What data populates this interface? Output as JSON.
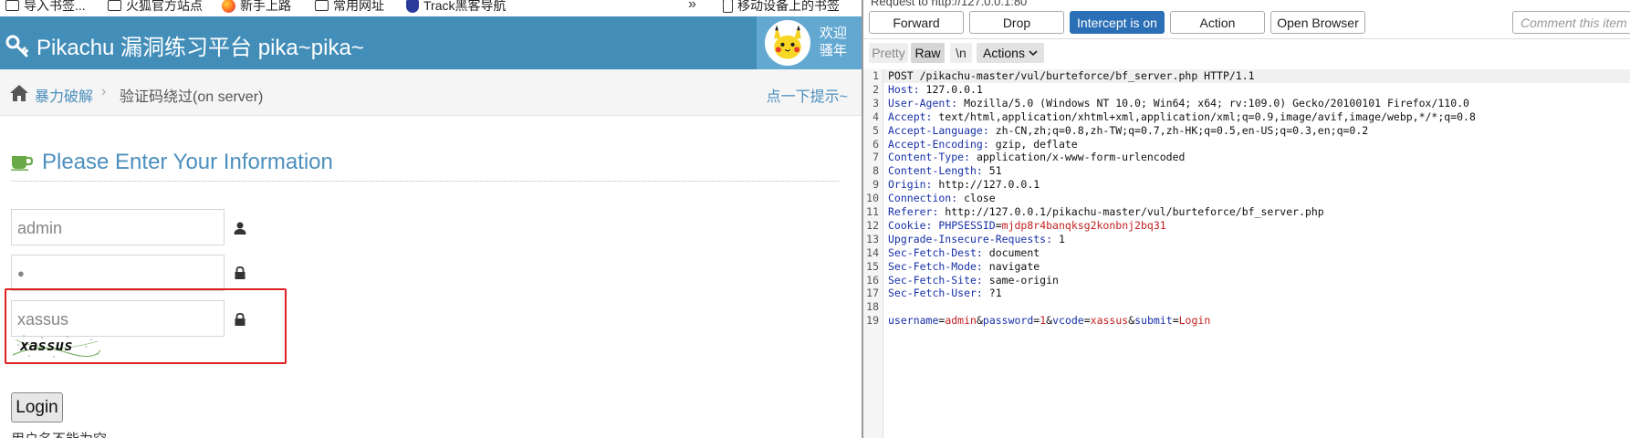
{
  "bookmarks": [
    {
      "label": "导入书签...",
      "icon": "folder-icon"
    },
    {
      "label": "火狐官方站点",
      "icon": "folder-icon"
    },
    {
      "label": "新手上路",
      "icon": "firefox-icon"
    },
    {
      "label": "常用网址",
      "icon": "folder-icon"
    },
    {
      "label": "Track黑客导航",
      "icon": "track-icon"
    },
    {
      "label": "移动设备上的书签",
      "icon": "device-icon"
    }
  ],
  "header": {
    "app_title": "Pikachu 漏洞练习平台 pika~pika~",
    "welcome_line1": "欢迎",
    "welcome_line2": "骚年"
  },
  "breadcrumb": {
    "section": "暴力破解",
    "page": "验证码绕过(on server)",
    "hint": "点一下提示~"
  },
  "form": {
    "title": "Please Enter Your Information",
    "username_value": "admin",
    "password_value": "●",
    "vcode_value": "xassus",
    "captcha_text": "xassus",
    "login_label": "Login",
    "bottom_text": "用户名不能为空"
  },
  "burp": {
    "request_to": "Request to http://127.0.0.1:80",
    "buttons": {
      "forward": "Forward",
      "drop": "Drop",
      "intercept": "Intercept is on",
      "action": "Action",
      "open_browser": "Open Browser"
    },
    "comment_placeholder": "Comment this item",
    "tabs": {
      "pretty": "Pretty",
      "raw": "Raw",
      "newline": "\\n",
      "actions": "Actions"
    },
    "accent_color": "#2b6fb6",
    "lines": [
      {
        "n": "1",
        "parts": [
          {
            "t": "POST /pikachu-master/vul/burteforce/bf_server.php HTTP/1.1",
            "c": ""
          }
        ]
      },
      {
        "n": "2",
        "parts": [
          {
            "t": "Host:",
            "c": "k"
          },
          {
            "t": " 127.0.0.1",
            "c": ""
          }
        ]
      },
      {
        "n": "3",
        "parts": [
          {
            "t": "User-Agent:",
            "c": "k"
          },
          {
            "t": " Mozilla/5.0 (Windows NT 10.0; Win64; x64; rv:109.0) Gecko/20100101 Firefox/110.0",
            "c": ""
          }
        ]
      },
      {
        "n": "4",
        "parts": [
          {
            "t": "Accept:",
            "c": "k"
          },
          {
            "t": " text/html,application/xhtml+xml,application/xml;q=0.9,image/avif,image/webp,*/*;q=0.8",
            "c": ""
          }
        ]
      },
      {
        "n": "5",
        "parts": [
          {
            "t": "Accept-Language:",
            "c": "k"
          },
          {
            "t": " zh-CN,zh;q=0.8,zh-TW;q=0.7,zh-HK;q=0.5,en-US;q=0.3,en;q=0.2",
            "c": ""
          }
        ]
      },
      {
        "n": "6",
        "parts": [
          {
            "t": "Accept-Encoding:",
            "c": "k"
          },
          {
            "t": " gzip, deflate",
            "c": ""
          }
        ]
      },
      {
        "n": "7",
        "parts": [
          {
            "t": "Content-Type:",
            "c": "k"
          },
          {
            "t": " application/x-www-form-urlencoded",
            "c": ""
          }
        ]
      },
      {
        "n": "8",
        "parts": [
          {
            "t": "Content-Length:",
            "c": "k"
          },
          {
            "t": " 51",
            "c": ""
          }
        ]
      },
      {
        "n": "9",
        "parts": [
          {
            "t": "Origin:",
            "c": "k"
          },
          {
            "t": " http://127.0.0.1",
            "c": ""
          }
        ]
      },
      {
        "n": "10",
        "parts": [
          {
            "t": "Connection:",
            "c": "k"
          },
          {
            "t": " close",
            "c": ""
          }
        ]
      },
      {
        "n": "11",
        "parts": [
          {
            "t": "Referer:",
            "c": "k"
          },
          {
            "t": " http://127.0.0.1/pikachu-master/vul/burteforce/bf_server.php",
            "c": ""
          }
        ]
      },
      {
        "n": "12",
        "parts": [
          {
            "t": "Cookie:",
            "c": "k"
          },
          {
            "t": " PHPSESSID",
            "c": "k"
          },
          {
            "t": "=",
            "c": ""
          },
          {
            "t": "mjdp8r4banqksg2konbnj2bq31",
            "c": "v"
          }
        ]
      },
      {
        "n": "13",
        "parts": [
          {
            "t": "Upgrade-Insecure-Requests:",
            "c": "k"
          },
          {
            "t": " 1",
            "c": ""
          }
        ]
      },
      {
        "n": "14",
        "parts": [
          {
            "t": "Sec-Fetch-Dest:",
            "c": "k"
          },
          {
            "t": " document",
            "c": ""
          }
        ]
      },
      {
        "n": "15",
        "parts": [
          {
            "t": "Sec-Fetch-Mode:",
            "c": "k"
          },
          {
            "t": " navigate",
            "c": ""
          }
        ]
      },
      {
        "n": "16",
        "parts": [
          {
            "t": "Sec-Fetch-Site:",
            "c": "k"
          },
          {
            "t": " same-origin",
            "c": ""
          }
        ]
      },
      {
        "n": "17",
        "parts": [
          {
            "t": "Sec-Fetch-User:",
            "c": "k"
          },
          {
            "t": " ?1",
            "c": ""
          }
        ]
      },
      {
        "n": "18",
        "parts": []
      },
      {
        "n": "19",
        "parts": [
          {
            "t": "username",
            "c": "k"
          },
          {
            "t": "=",
            "c": ""
          },
          {
            "t": "admin",
            "c": "v"
          },
          {
            "t": "&",
            "c": ""
          },
          {
            "t": "password",
            "c": "k"
          },
          {
            "t": "=",
            "c": ""
          },
          {
            "t": "1",
            "c": "v"
          },
          {
            "t": "&",
            "c": ""
          },
          {
            "t": "vcode",
            "c": "k"
          },
          {
            "t": "=",
            "c": ""
          },
          {
            "t": "xassus",
            "c": "v"
          },
          {
            "t": "&",
            "c": ""
          },
          {
            "t": "submit",
            "c": "k"
          },
          {
            "t": "=",
            "c": ""
          },
          {
            "t": "Login",
            "c": "v"
          }
        ]
      }
    ]
  }
}
